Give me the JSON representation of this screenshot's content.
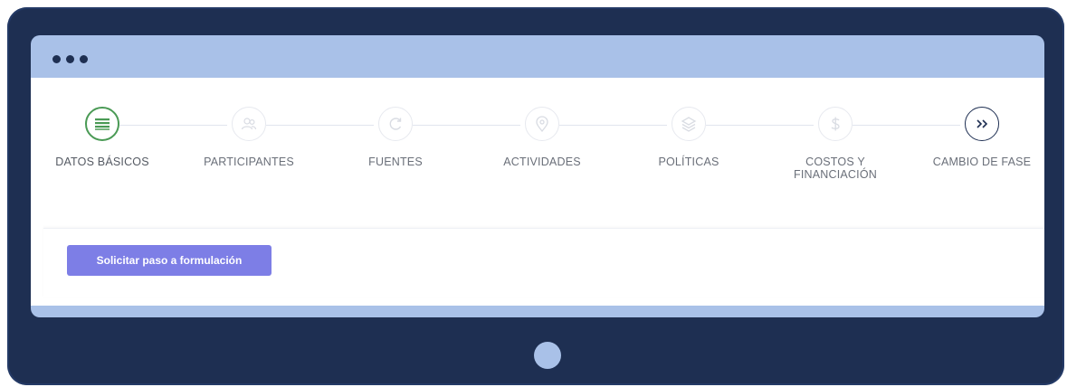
{
  "window": {
    "controls": [
      "dot",
      "dot",
      "dot"
    ]
  },
  "stepper": {
    "steps": [
      {
        "label": "DATOS BÁSICOS",
        "icon": "list-icon",
        "state": "active"
      },
      {
        "label": "PARTICIPANTES",
        "icon": "users-icon",
        "state": "inactive"
      },
      {
        "label": "FUENTES",
        "icon": "refresh-icon",
        "state": "inactive"
      },
      {
        "label": "ACTIVIDADES",
        "icon": "location-pin-icon",
        "state": "inactive"
      },
      {
        "label": "POLÍTICAS",
        "icon": "layers-icon",
        "state": "inactive"
      },
      {
        "label": "COSTOS Y\nFINANCIACIÓN",
        "icon": "dollar-icon",
        "state": "inactive"
      },
      {
        "label": "CAMBIO DE FASE",
        "icon": "double-chevron-right-icon",
        "state": "inactive"
      }
    ]
  },
  "actions": {
    "request_button": "Solicitar paso a formulación"
  },
  "colors": {
    "monitor_frame": "#1e2f52",
    "screen_bezel": "#a9c1e8",
    "active_step": "#4a9a55",
    "button": "#7d7ee6"
  }
}
